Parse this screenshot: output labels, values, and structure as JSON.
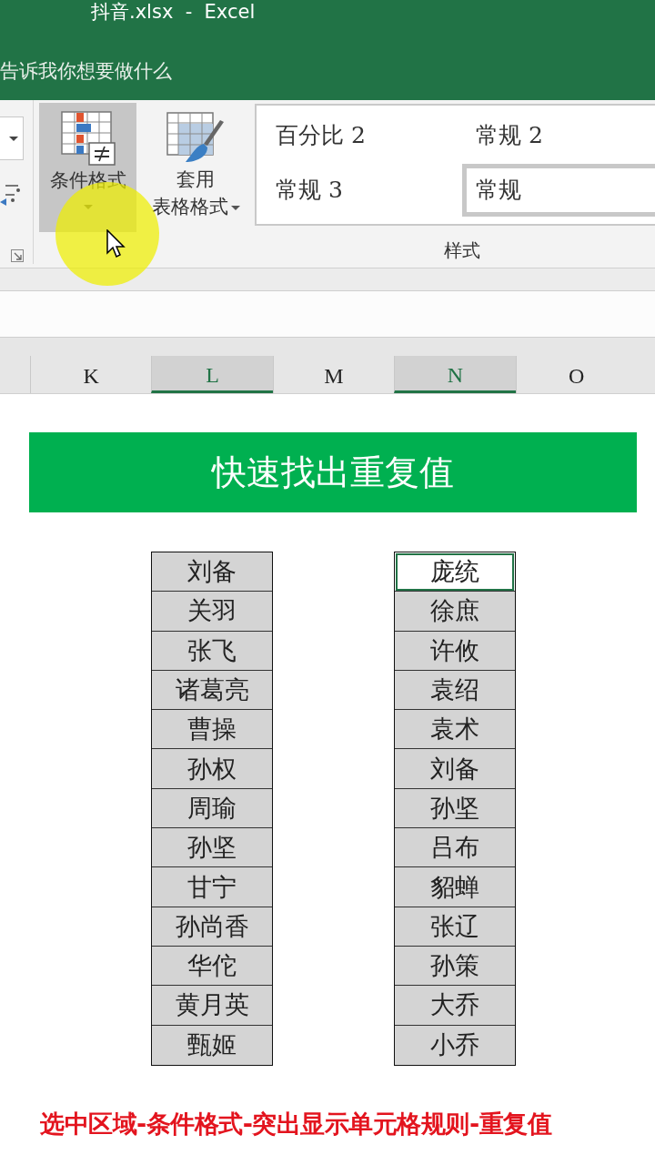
{
  "window": {
    "title": "抖音.xlsx  -  Excel"
  },
  "tell_me": {
    "placeholder": "告诉我你想要做什么"
  },
  "ribbon": {
    "buttons": [
      {
        "kind": "conditional",
        "lines": [
          "条件格式"
        ],
        "hovered": true
      },
      {
        "kind": "table",
        "lines": [
          "套用",
          "表格格式"
        ],
        "hovered": false
      }
    ],
    "styles": [
      {
        "label": "百分比 2",
        "selected": false
      },
      {
        "label": "常规 2",
        "selected": false
      },
      {
        "label": "常规 3",
        "selected": false
      },
      {
        "label": "常规",
        "selected": true
      }
    ],
    "group_label": "样式"
  },
  "columns": [
    {
      "label": "K",
      "selected": false
    },
    {
      "label": "L",
      "selected": true
    },
    {
      "label": "M",
      "selected": false
    },
    {
      "label": "N",
      "selected": true
    },
    {
      "label": "O",
      "selected": false
    }
  ],
  "banner": {
    "title": "快速找出重复值"
  },
  "lists": [
    {
      "items": [
        {
          "text": "刘备",
          "selected": false
        },
        {
          "text": "关羽",
          "selected": false
        },
        {
          "text": "张飞",
          "selected": false
        },
        {
          "text": "诸葛亮",
          "selected": false
        },
        {
          "text": "曹操",
          "selected": false
        },
        {
          "text": "孙权",
          "selected": false
        },
        {
          "text": "周瑜",
          "selected": false
        },
        {
          "text": "孙坚",
          "selected": false
        },
        {
          "text": "甘宁",
          "selected": false
        },
        {
          "text": "孙尚香",
          "selected": false
        },
        {
          "text": "华佗",
          "selected": false
        },
        {
          "text": "黄月英",
          "selected": false
        },
        {
          "text": "甄姬",
          "selected": false
        }
      ]
    },
    {
      "items": [
        {
          "text": "庞统",
          "selected": true
        },
        {
          "text": "徐庶",
          "selected": false
        },
        {
          "text": "许攸",
          "selected": false
        },
        {
          "text": "袁绍",
          "selected": false
        },
        {
          "text": "袁术",
          "selected": false
        },
        {
          "text": "刘备",
          "selected": false
        },
        {
          "text": "孙坚",
          "selected": false
        },
        {
          "text": "吕布",
          "selected": false
        },
        {
          "text": "貂蝉",
          "selected": false
        },
        {
          "text": "张辽",
          "selected": false
        },
        {
          "text": "孙策",
          "selected": false
        },
        {
          "text": "大乔",
          "selected": false
        },
        {
          "text": "小乔",
          "selected": false
        }
      ]
    }
  ],
  "caption": "选中区域-条件格式-突出显示单元格规则-重复值"
}
